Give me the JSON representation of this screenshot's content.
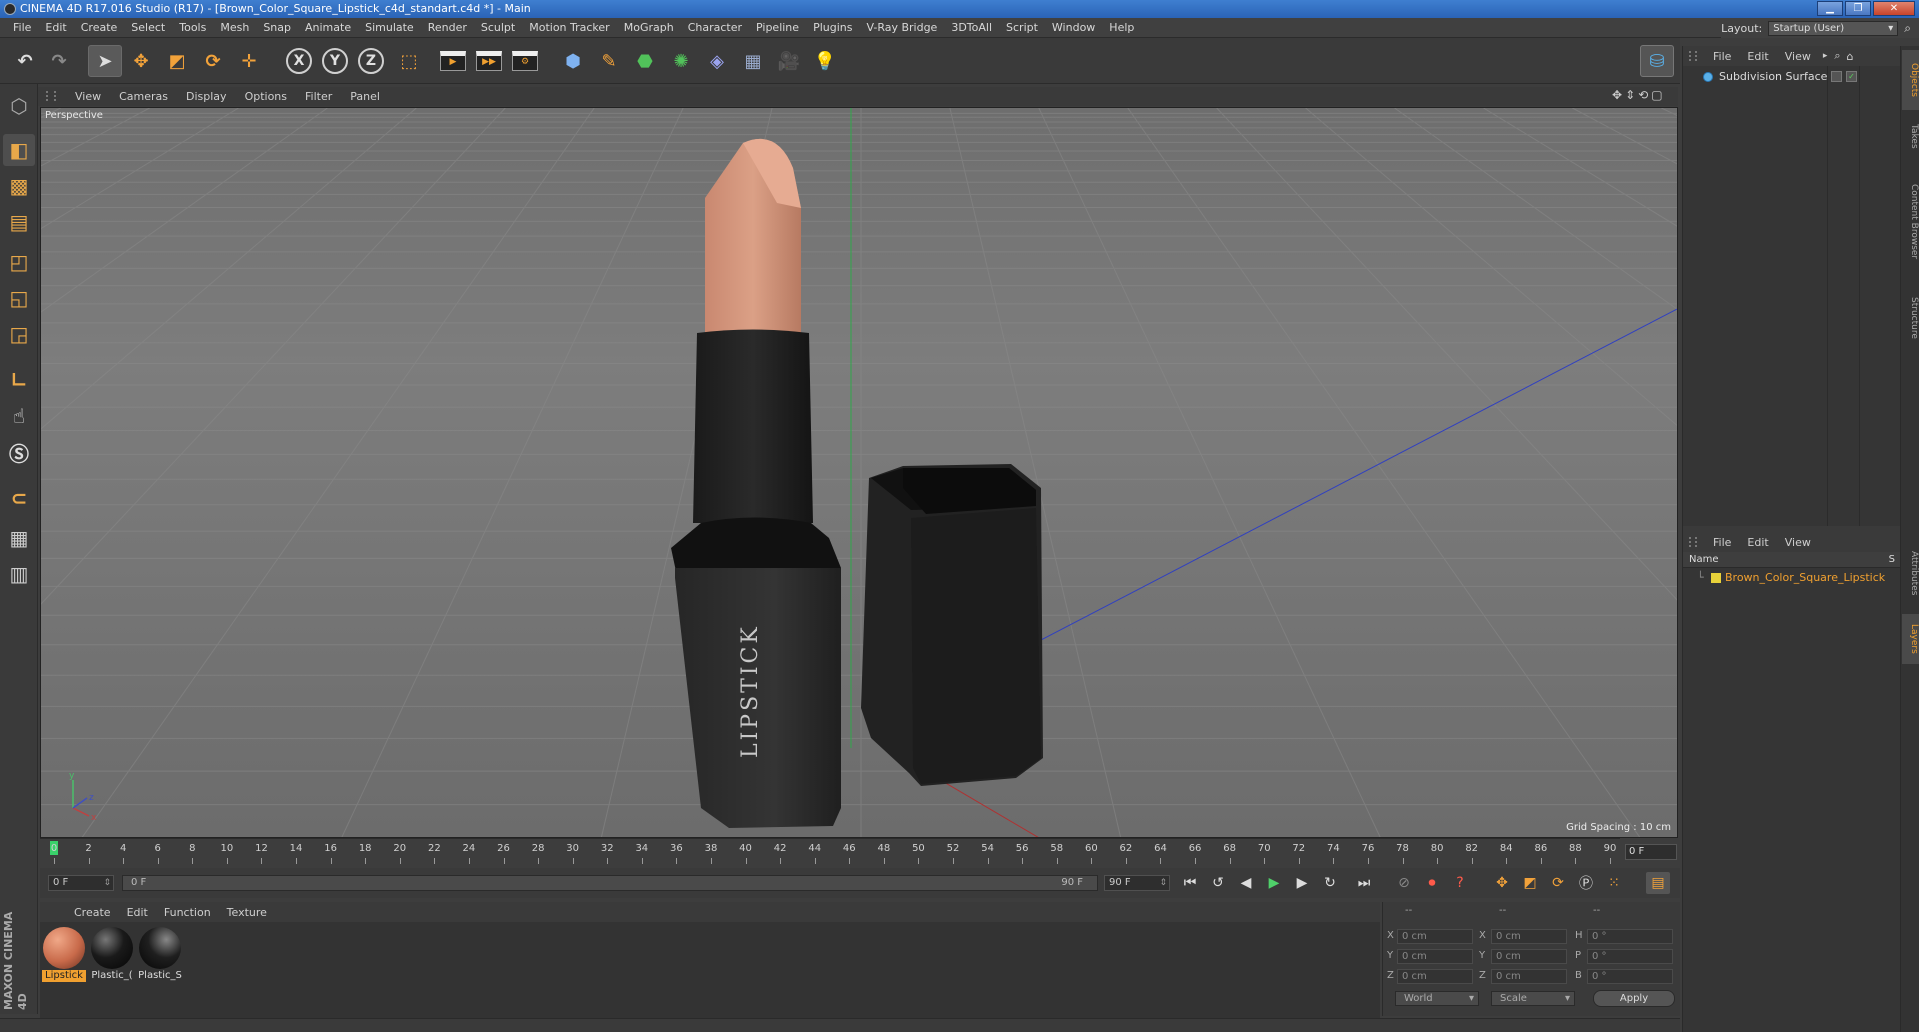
{
  "window": {
    "title": "CINEMA 4D R17.016 Studio (R17) - [Brown_Color_Square_Lipstick_c4d_standart.c4d *] - Main",
    "minimize": "▁",
    "maximize": "❐",
    "close": "✕"
  },
  "menubar": {
    "items": [
      "File",
      "Edit",
      "Create",
      "Select",
      "Tools",
      "Mesh",
      "Snap",
      "Animate",
      "Simulate",
      "Render",
      "Sculpt",
      "Motion Tracker",
      "MoGraph",
      "Character",
      "Pipeline",
      "Plugins",
      "V-Ray Bridge",
      "3DToAll",
      "Script",
      "Window",
      "Help"
    ],
    "layout_label": "Layout:",
    "layout_value": "Startup (User)"
  },
  "toolbar": {
    "axis_x": "X",
    "axis_y": "Y",
    "axis_z": "Z"
  },
  "viewport": {
    "menu": [
      "View",
      "Cameras",
      "Display",
      "Options",
      "Filter",
      "Panel"
    ],
    "label": "Perspective",
    "grid_spacing": "Grid Spacing : 10 cm",
    "product_text": "LIPSTICK",
    "axis_labels": {
      "x": "x",
      "y": "y",
      "z": "z"
    },
    "colors": {
      "lipstick_bullet": "#d7957a",
      "case": "#1a1a1a",
      "bg": "#767676"
    }
  },
  "timeline": {
    "ticks": [
      "0",
      "2",
      "4",
      "6",
      "8",
      "10",
      "12",
      "14",
      "16",
      "18",
      "20",
      "22",
      "24",
      "26",
      "28",
      "30",
      "32",
      "34",
      "36",
      "38",
      "40",
      "42",
      "44",
      "46",
      "48",
      "50",
      "52",
      "54",
      "56",
      "58",
      "60",
      "62",
      "64",
      "66",
      "68",
      "70",
      "72",
      "74",
      "76",
      "78",
      "80",
      "82",
      "84",
      "86",
      "88",
      "90"
    ],
    "current_frame": "0 F",
    "start_field": "0 F",
    "slider_start": "0 F",
    "slider_end": "90 F",
    "end_field": "90 F"
  },
  "materials": {
    "menu": [
      "Create",
      "Edit",
      "Function",
      "Texture"
    ],
    "items": [
      {
        "label": "Lipstick",
        "color": "#c86a4a",
        "selected": true
      },
      {
        "label": "Plastic_(",
        "color": "#1a1a1a",
        "selected": false
      },
      {
        "label": "Plastic_S",
        "color": "#1f1f1f",
        "selected": false
      }
    ]
  },
  "coords": {
    "headers": [
      "--",
      "--",
      "--"
    ],
    "rows": [
      {
        "a": "X",
        "av": "0 cm",
        "b": "X",
        "bv": "0 cm",
        "c": "H",
        "cv": "0 °"
      },
      {
        "a": "Y",
        "av": "0 cm",
        "b": "Y",
        "bv": "0 cm",
        "c": "P",
        "cv": "0 °"
      },
      {
        "a": "Z",
        "av": "0 cm",
        "b": "Z",
        "bv": "0 cm",
        "c": "B",
        "cv": "0 °"
      }
    ],
    "mode1": "World",
    "mode2": "Scale",
    "apply": "Apply"
  },
  "objects": {
    "menu": [
      "File",
      "Edit",
      "View"
    ],
    "item": "Subdivision Surface"
  },
  "layers": {
    "menu": [
      "File",
      "Edit",
      "View"
    ],
    "col_name": "Name",
    "col_s": "S",
    "item": "Brown_Color_Square_Lipstick"
  },
  "side_tabs": [
    "Objects",
    "Takes",
    "Content Browser",
    "Structure",
    "Attributes",
    "Layers"
  ],
  "maxon": "MAXON CINEMA 4D"
}
